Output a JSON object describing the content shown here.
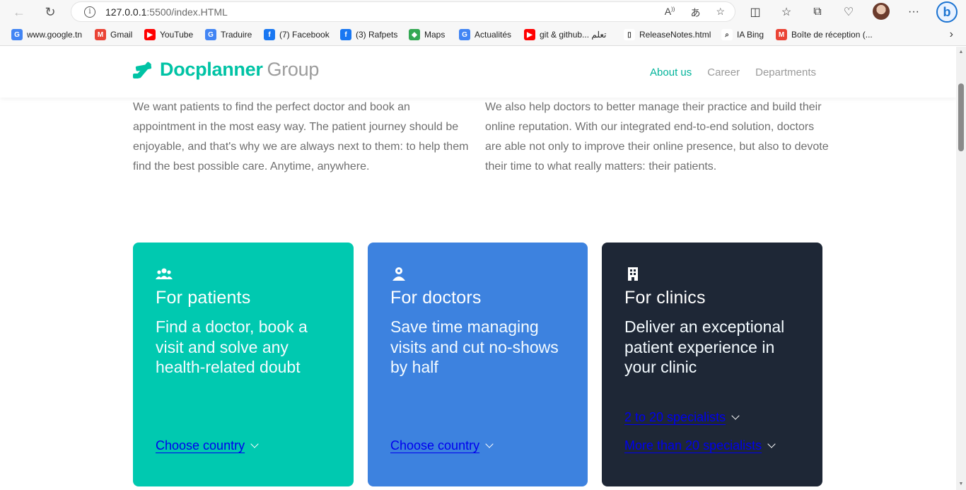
{
  "browser": {
    "url_host": "127.0.0.1",
    "url_rest": ":5500/index.HTML",
    "bookmarks": [
      {
        "label": "www.google.tn",
        "icon": "google-icon",
        "color": "#4285f4",
        "glyph": "G"
      },
      {
        "label": "Gmail",
        "icon": "gmail-icon",
        "color": "#ea4335",
        "glyph": "M"
      },
      {
        "label": "YouTube",
        "icon": "youtube-icon",
        "color": "#ff0000",
        "glyph": "▶"
      },
      {
        "label": "Traduire",
        "icon": "translate-icon",
        "color": "#4285f4",
        "glyph": "G"
      },
      {
        "label": "(7) Facebook",
        "icon": "facebook-icon",
        "color": "#1877f2",
        "glyph": "f"
      },
      {
        "label": "(3) Rafpets",
        "icon": "facebook-icon",
        "color": "#1877f2",
        "glyph": "f"
      },
      {
        "label": "Maps",
        "icon": "maps-icon",
        "color": "#34a853",
        "glyph": "◆"
      },
      {
        "label": "Actualités",
        "icon": "news-icon",
        "color": "#4285f4",
        "glyph": "G"
      },
      {
        "label": "git & github... تعلم",
        "icon": "youtube-icon",
        "color": "#ff0000",
        "glyph": "▶"
      },
      {
        "label": "ReleaseNotes.html",
        "icon": "file-icon",
        "color": "#ffffff",
        "glyph": "▯"
      },
      {
        "label": "IA Bing",
        "icon": "search-icon",
        "color": "#ffffff",
        "glyph": "⌕"
      },
      {
        "label": "Boîte de réception (...",
        "icon": "gmail-icon",
        "color": "#ea4335",
        "glyph": "M"
      }
    ]
  },
  "header": {
    "logo_main": "Docplanner",
    "logo_sub": "Group",
    "menu": [
      {
        "label": "About us",
        "active": true
      },
      {
        "label": "Career",
        "active": false
      },
      {
        "label": "Departments",
        "active": false
      }
    ]
  },
  "intro": {
    "left": "We want patients to find the perfect doctor and book an appointment in the most easy way. The patient journey should be enjoyable, and that's why we are always next to them: to help them find the best possible care. Anytime, anywhere.",
    "right": "We also help doctors to better manage their practice and build their online reputation. With our integrated end-to-end solution, doctors are able not only to improve their online presence, but also to devote their time to what really matters: their patients."
  },
  "cards": {
    "patients": {
      "title": "For patients",
      "text": "Find a doctor, book a visit and solve any health-related doubt",
      "link": "Choose country",
      "color": "#00c9b0"
    },
    "doctors": {
      "title": "For doctors",
      "text": "Save time managing visits and cut no-shows by half",
      "link": "Choose country",
      "color": "#3d82df"
    },
    "clinics": {
      "title": "For clinics",
      "text": "Deliver an exceptional patient experience in your clinic",
      "link1": "2 to 20 specialists",
      "link2": "More than 20 specialists",
      "color": "#1e2736"
    }
  }
}
